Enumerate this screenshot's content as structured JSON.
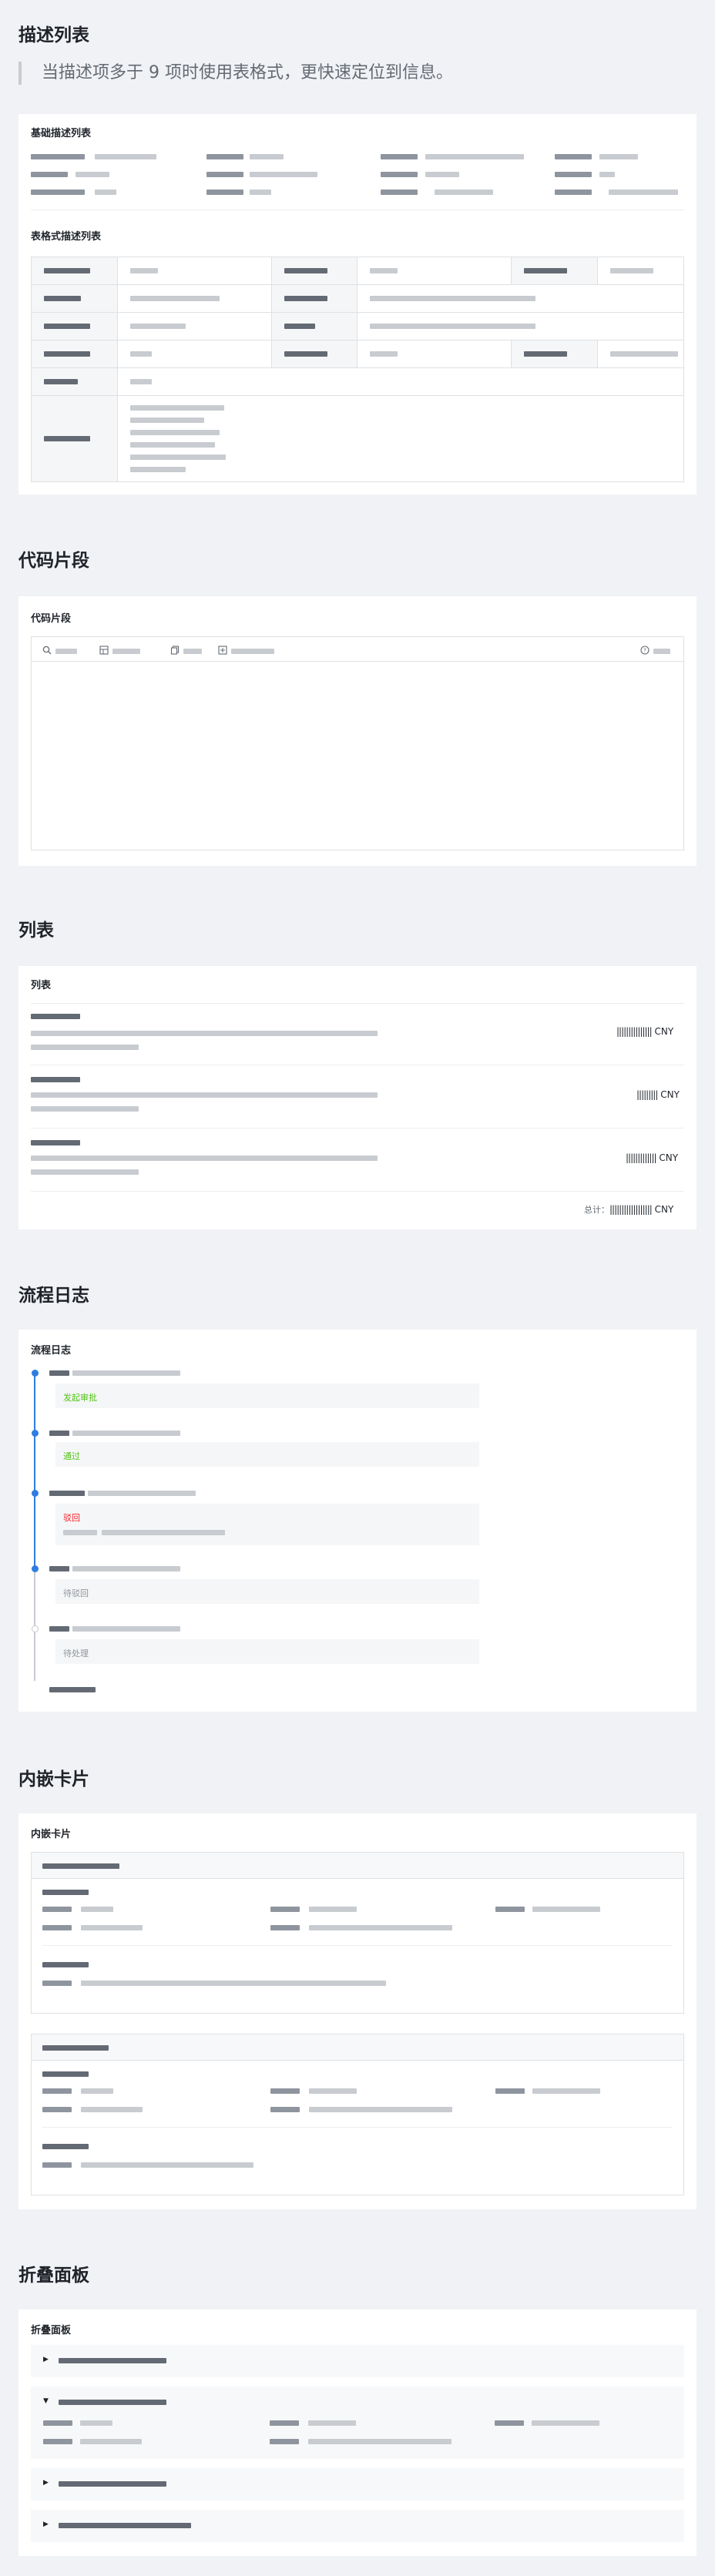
{
  "sections": {
    "desc": {
      "title": "描述列表",
      "hint": "当描述项多于 9 项时使用表格式，更快速定位到信息。",
      "basic_title": "基础描述列表",
      "table_title": "表格式描述列表"
    },
    "code": {
      "title": "代码片段",
      "card_title": "代码片段"
    },
    "list": {
      "title": "列表",
      "card_title": "列表",
      "currency": "CNY",
      "total_label": "总计："
    },
    "flow": {
      "title": "流程日志",
      "card_title": "流程日志",
      "statuses": [
        "发起审批",
        "通过",
        "驳回",
        "待驳回",
        "待处理"
      ]
    },
    "inner": {
      "title": "内嵌卡片",
      "card_title": "内嵌卡片"
    },
    "collapse": {
      "title": "折叠面板",
      "card_title": "折叠面板"
    }
  },
  "icons": [
    "search-icon",
    "table-icon",
    "copy-icon",
    "expand-icon",
    "help-icon",
    "caret-right-icon",
    "caret-down-icon"
  ],
  "colors": {
    "primary": "#2f7de1",
    "success": "#52c41a",
    "danger": "#f5222d",
    "pending": "#8f959e",
    "text": "#1f2329",
    "border": "#dee0e3"
  }
}
